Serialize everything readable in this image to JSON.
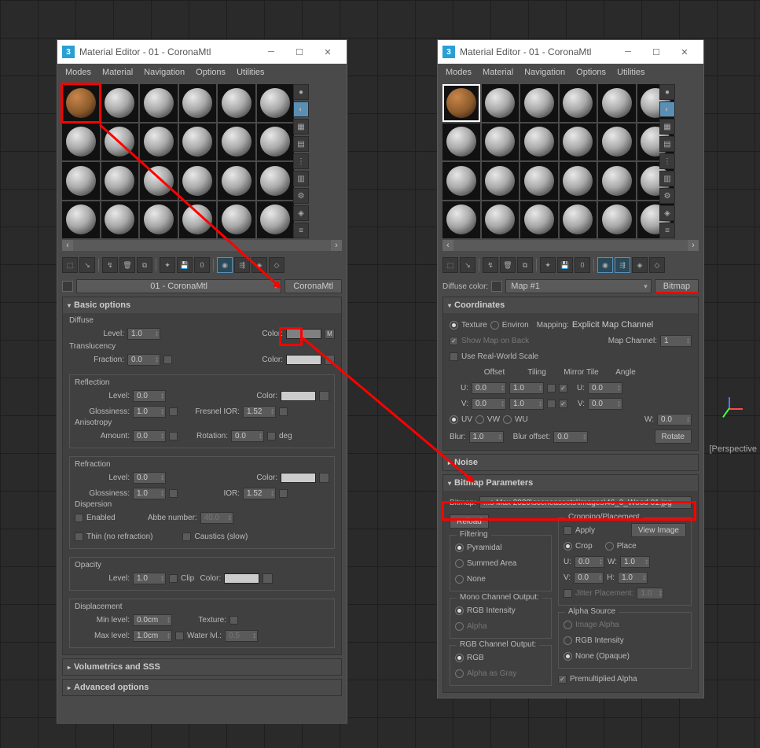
{
  "windows": {
    "left": {
      "title": "Material Editor - 01 - CoronaMtl"
    },
    "right": {
      "title": "Material Editor - 01 - CoronaMtl"
    }
  },
  "menu": {
    "modes": "Modes",
    "material": "Material",
    "navigation": "Navigation",
    "options": "Options",
    "utilities": "Utilities"
  },
  "mat_select": {
    "name": "01 - CoronaMtl",
    "type": "CoronaMtl"
  },
  "rollouts": {
    "basic": "Basic options",
    "volumetrics": "Volumetrics and SSS",
    "advanced": "Advanced options",
    "coordinates": "Coordinates",
    "noise": "Noise",
    "bitmap_params": "Bitmap Parameters"
  },
  "labels": {
    "diffuse": "Diffuse",
    "level": "Level:",
    "color": "Color:",
    "translucency": "Translucency",
    "fraction": "Fraction:",
    "reflection": "Reflection",
    "glossiness": "Glossiness:",
    "fresnel": "Fresnel IOR:",
    "anisotropy": "Anisotropy",
    "amount": "Amount:",
    "rotation": "Rotation:",
    "deg": "deg",
    "refraction": "Refraction",
    "ior": "IOR:",
    "dispersion": "Dispersion",
    "enabled": "Enabled",
    "abbe": "Abbe number:",
    "thin": "Thin (no refraction)",
    "caustics": "Caustics (slow)",
    "opacity": "Opacity",
    "clip": "Clip",
    "displacement": "Displacement",
    "min_level": "Min level:",
    "max_level": "Max level:",
    "texture": "Texture:",
    "water": "Water lvl.:",
    "diffuse_color": "Diffuse color:",
    "map_name": "Map #1",
    "bitmap_btn": "Bitmap",
    "texture_radio": "Texture",
    "environ": "Environ",
    "mapping": "Mapping:",
    "explicit": "Explicit Map Channel",
    "show_map": "Show Map on Back",
    "map_channel": "Map Channel:",
    "real_world": "Use Real-World Scale",
    "offset": "Offset",
    "tiling": "Tiling",
    "mirror_tile": "Mirror Tile",
    "angle": "Angle",
    "u": "U:",
    "v": "V:",
    "w": "W:",
    "uv": "UV",
    "vw": "VW",
    "wu": "WU",
    "blur": "Blur:",
    "blur_offset": "Blur offset:",
    "rotate": "Rotate",
    "bitmap": "Bitmap:",
    "reload": "Reload",
    "cropping": "Cropping/Placement",
    "apply": "Apply",
    "view_image": "View Image",
    "crop": "Crop",
    "place": "Place",
    "h": "H:",
    "jitter": "Jitter Placement:",
    "filtering": "Filtering",
    "pyramidal": "Pyramidal",
    "summed": "Summed Area",
    "none": "None",
    "mono": "Mono Channel Output:",
    "rgb_intensity": "RGB Intensity",
    "alpha": "Alpha",
    "rgb_out": "RGB Channel Output:",
    "rgb": "RGB",
    "alpha_gray": "Alpha as Gray",
    "alpha_source": "Alpha Source",
    "image_alpha": "Image Alpha",
    "none_opaque": "None (Opaque)",
    "premult": "Premultiplied Alpha",
    "m_btn": "M"
  },
  "values": {
    "diffuse_level": "1.0",
    "trans_fraction": "0.0",
    "refl_level": "0.0",
    "refl_gloss": "1.0",
    "fresnel": "1.52",
    "aniso_amount": "0.0",
    "aniso_rot": "0.0",
    "refr_level": "0.0",
    "refr_gloss": "1.0",
    "refr_ior": "1.52",
    "abbe": "40.0",
    "opacity_level": "1.0",
    "disp_min": "0.0cm",
    "disp_max": "1.0cm",
    "water": "0.5",
    "map_channel": "1",
    "u_offset": "0.0",
    "v_offset": "0.0",
    "u_tile": "1.0",
    "v_tile": "1.0",
    "u_angle": "0.0",
    "v_angle": "0.0",
    "w_angle": "0.0",
    "blur": "1.0",
    "blur_offset": "0.0",
    "bitmap_path": "...s Max 2020\\sceneassets\\images\\46_0_Wood 01.jpg",
    "crop_u": "0.0",
    "crop_v": "0.0",
    "crop_w": "1.0",
    "crop_h": "1.0",
    "jitter": "1.0"
  },
  "viewport": {
    "label": "[Perspective"
  }
}
